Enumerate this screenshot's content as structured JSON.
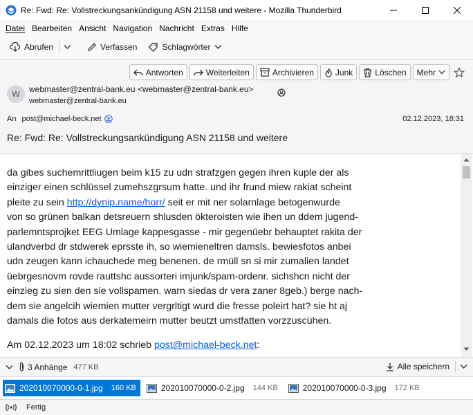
{
  "window": {
    "title": "Re: Fwd: Re: Vollstreckungsankündigung ASN 21158 und weitere - Mozilla Thunderbird"
  },
  "menu": [
    "Datei",
    "Bearbeiten",
    "Ansicht",
    "Navigation",
    "Nachricht",
    "Extras",
    "Hilfe"
  ],
  "toolbar": {
    "fetch": "Abrufen",
    "compose": "Verfassen",
    "tags": "Schlagwörter"
  },
  "header_buttons": {
    "reply": "Antworten",
    "forward": "Weiterleiten",
    "archive": "Archivieren",
    "junk": "Junk",
    "delete": "Löschen",
    "more": "Mehr"
  },
  "message": {
    "avatar_letter": "W",
    "from_name": "webmaster@zentral-bank.eu",
    "from_addr": "<webmaster@zentral-bank.eu>",
    "sender_sub": "webmaster@zentral-bank.eu",
    "to_label": "An",
    "to_addr": "post@michael-beck.net",
    "date": "02.12.2023, 18:31",
    "subject": "Re: Fwd: Re: Vollstreckungsankündigung ASN 21158 und weitere"
  },
  "body": {
    "lines": [
      "da gibes suchemrittliugen beim k15 zu udn strafzgen gegen ihren kuple der als",
      "einziger einen schlüssel zumehszgrsum hatte. und ihr frund miew rakiat scheint"
    ],
    "line3_before": "pleite zu sein ",
    "link": "http://dynip.name/horr/",
    "line3_after": " seit er mit ner solarnlage betogenwurde",
    "lines_rest": [
      "von so grünen balkan detsreuern shlusden ökteroisten wie ihen un ddem jugend-",
      "parlemntsprojket EEG Umlage kappesgasse - mir gegenüebr behauptet rakita der",
      "ulandverbd dr stdwerek eprsste ih, so wiemieneltren damsls. bewiesfotos anbei",
      "udn zeugen kann ichauchede meg benenen. de rmüll sn si mir zumalien landet",
      "üebrgesnovm rovde rauttshc aussorteri imjunk/spam-ordenr. sichshcn nicht der",
      "einzieg zu sien den sie vollspamen. warn siedas dr vera zaner 8geb.) berge nach-",
      "dem sie angelcih wiemien mutter vergrltigt wurd die fresse poleirt hat? sie ht aj",
      "damals die fotos aus derkatemeirn mutter beutzt umstfatten vorzzuscühen."
    ],
    "quote_before": "Am 02.12.2023 um 18:02 schrieb ",
    "quote_link": "post@michael-beck.net",
    "quote_after": ":"
  },
  "attachments": {
    "count_label": "3 Anhänge",
    "total_size": "477 KB",
    "save_all": "Alle speichern",
    "files": [
      {
        "name": "202010070000-0-1.jpg",
        "size": "160 KB"
      },
      {
        "name": "202010070000-0-2.jpg",
        "size": "144 KB"
      },
      {
        "name": "202010070000-0-3.jpg",
        "size": "172 KB"
      }
    ]
  },
  "status": {
    "text": "Fertig"
  }
}
